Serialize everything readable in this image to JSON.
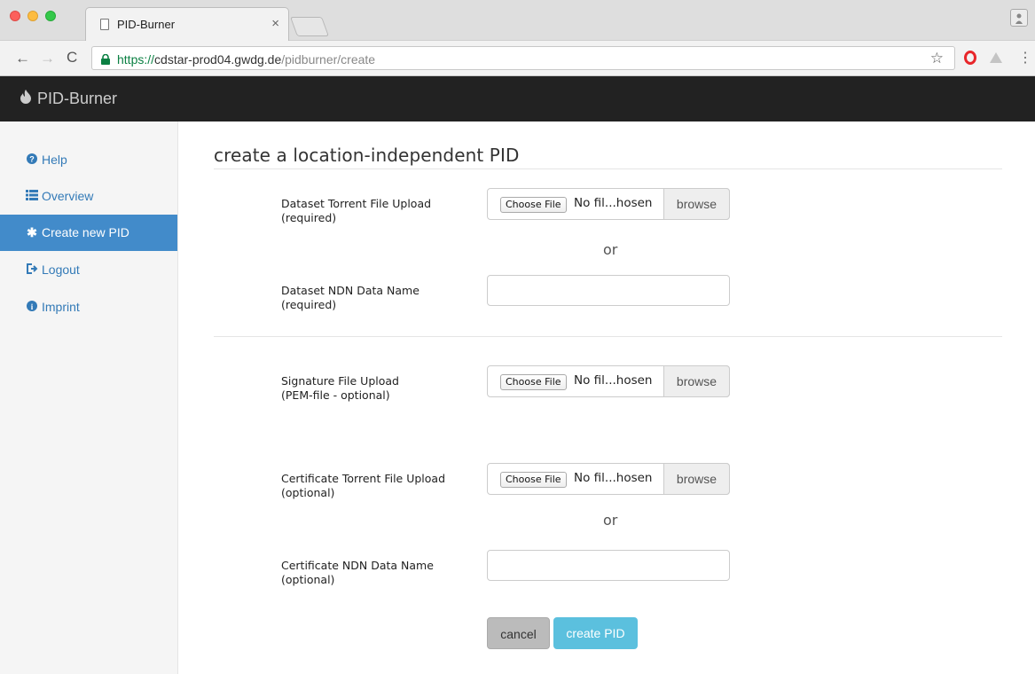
{
  "browser": {
    "tab_title": "PID-Burner",
    "tab_close": "×",
    "url_secure": "https://",
    "url_host": "cdstar-prod04.gwdg.de",
    "url_path": "/pidburner/create",
    "back_glyph": "←",
    "forward_glyph": "→",
    "reload_glyph": "C",
    "star_glyph": "☆",
    "menu_glyph": "⋮"
  },
  "navbar": {
    "brand": "PID-Burner",
    "brand_icon": "fire-icon"
  },
  "sidebar": {
    "items": [
      {
        "label": "Help",
        "icon": "question-circle-icon",
        "glyph": "?"
      },
      {
        "label": "Overview",
        "icon": "list-icon",
        "glyph": "☰"
      },
      {
        "label": "Create new PID",
        "icon": "asterisk-icon",
        "glyph": "✱",
        "active": true
      },
      {
        "label": "Logout",
        "icon": "logout-icon",
        "glyph": "↦"
      },
      {
        "label": "Imprint",
        "icon": "info-circle-icon",
        "glyph": "i"
      }
    ]
  },
  "main": {
    "title": "create a location-independent PID",
    "or_text": "or",
    "choose_file": "Choose File",
    "no_file": "No fil...hosen",
    "browse": "browse",
    "fields": {
      "dataset_torrent": {
        "label1": "Dataset Torrent File Upload",
        "label2": "(required)"
      },
      "dataset_ndn": {
        "label1": "Dataset NDN Data Name",
        "label2": "(required)",
        "value": ""
      },
      "signature": {
        "label1": "Signature File Upload",
        "label2": "(PEM-file - optional)"
      },
      "certificate_torrent": {
        "label1": "Certificate Torrent File Upload",
        "label2": "(optional)"
      },
      "certificate_ndn": {
        "label1": "Certificate NDN Data Name",
        "label2": "(optional)",
        "value": ""
      }
    },
    "cancel": "cancel",
    "create": "create PID"
  },
  "colors": {
    "navbar_bg": "#222222",
    "sidebar_active": "#428bca",
    "link": "#337ab7",
    "create_button": "#5bc0de",
    "cancel_button": "#bbbbbb"
  }
}
